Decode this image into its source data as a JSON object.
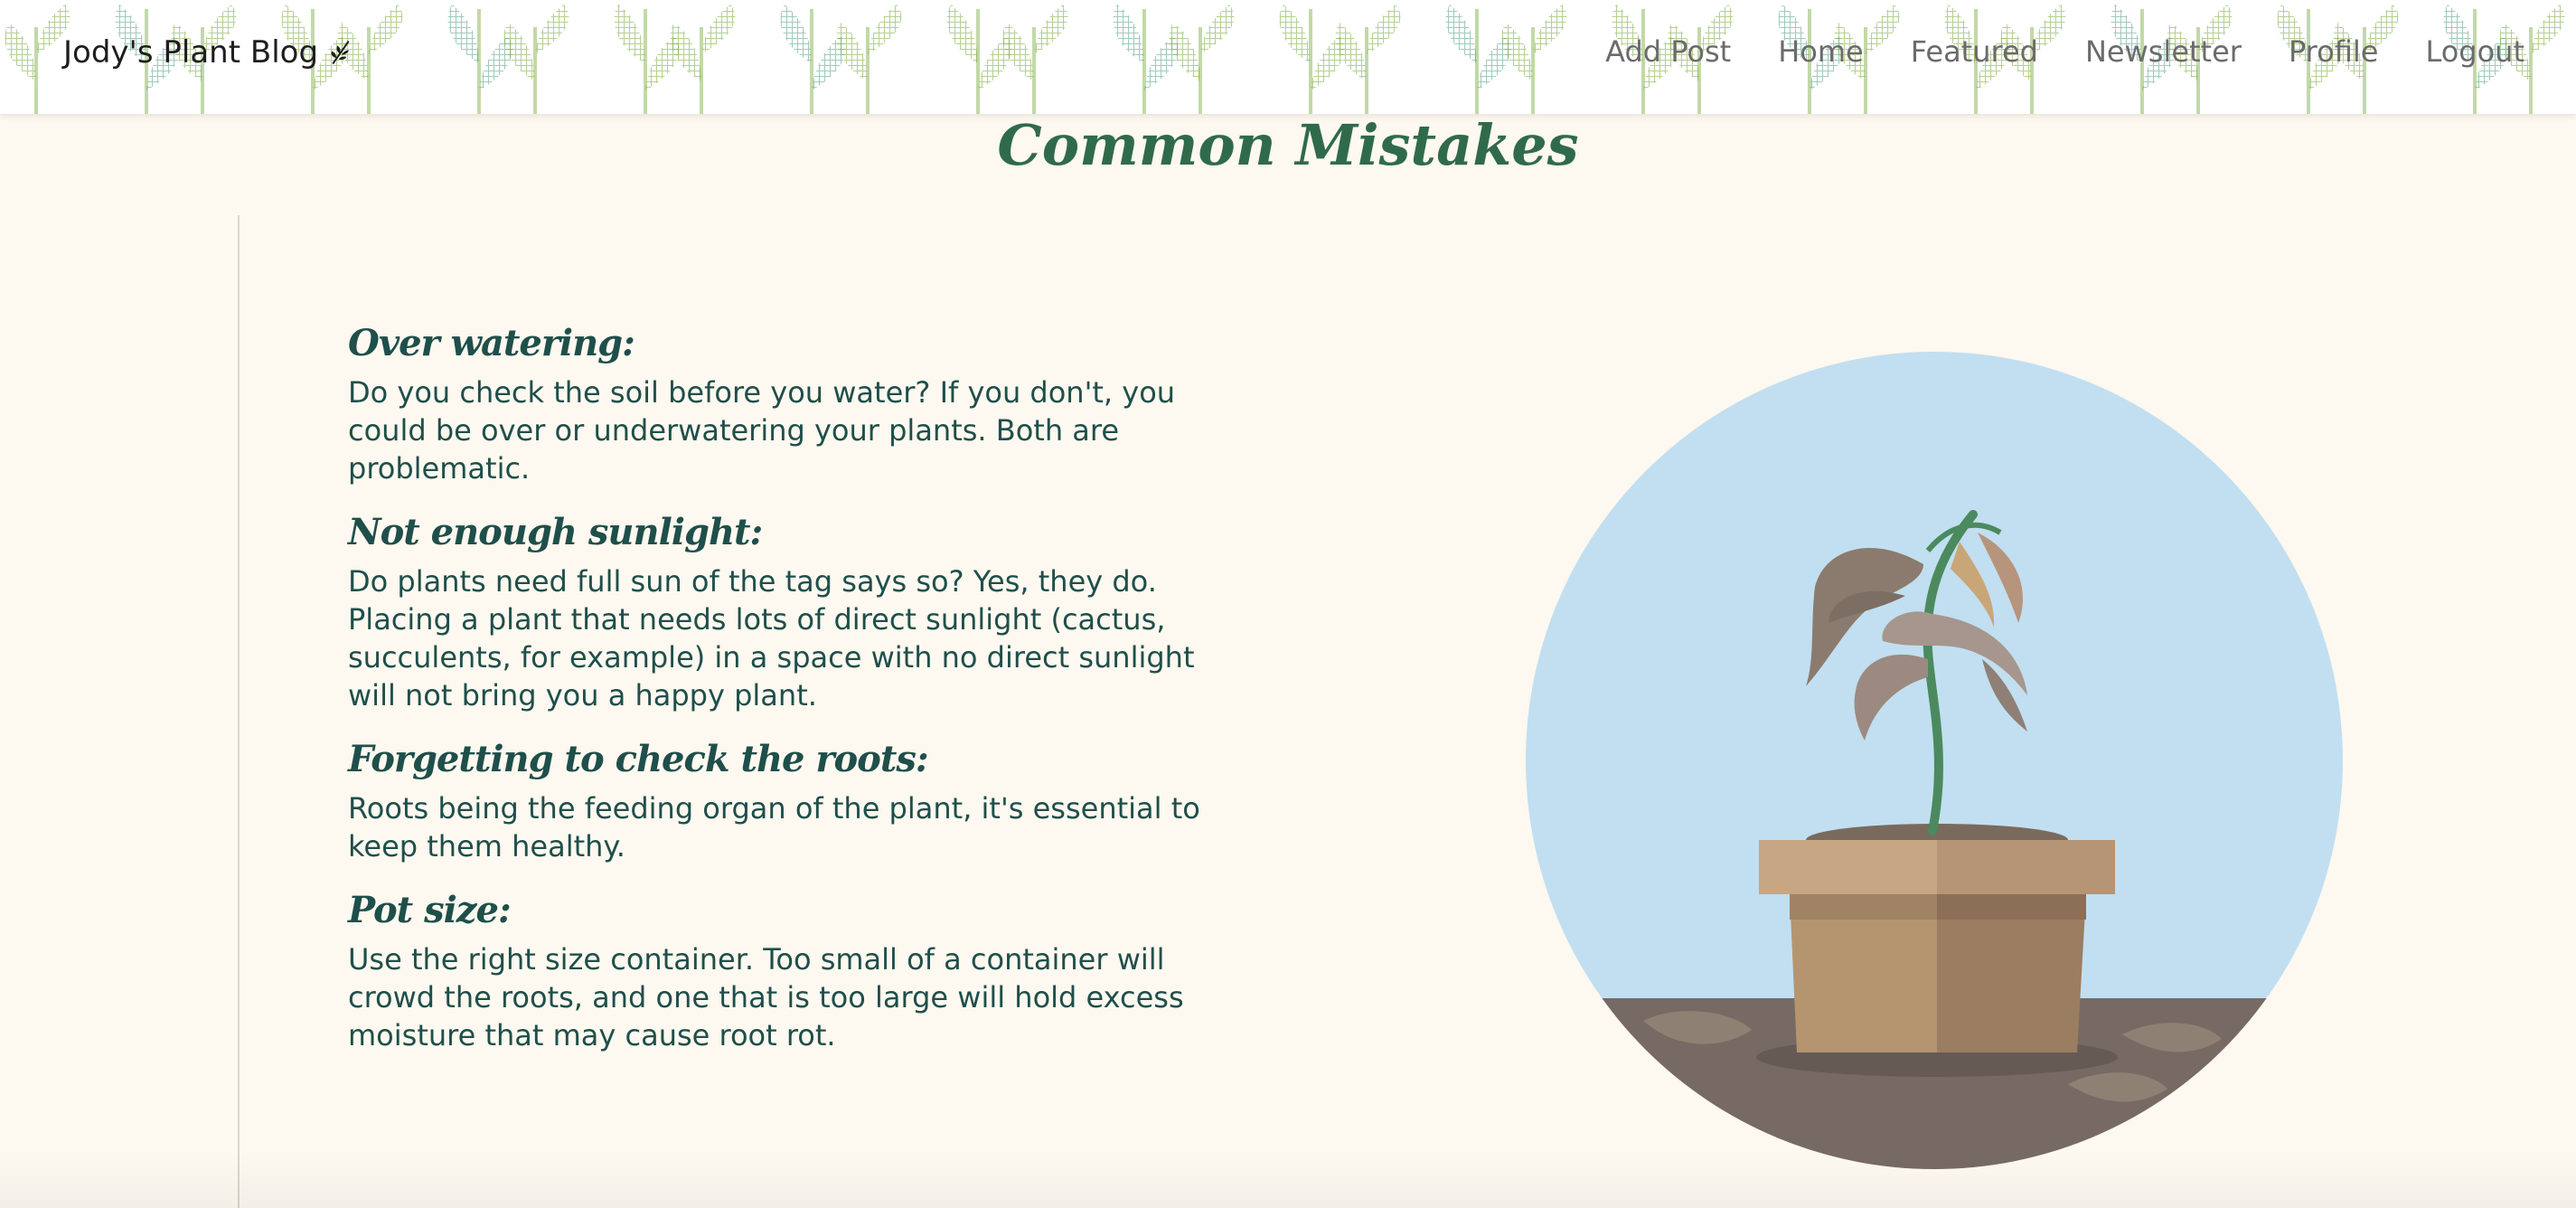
{
  "header": {
    "brand": "Jody's Plant Blog",
    "brand_icon": "leaf-sprig-icon",
    "nav": [
      "Add Post",
      "Home",
      "Featured",
      "Newsletter",
      "Profile",
      "Logout"
    ]
  },
  "page_title": "Common Mistakes",
  "sections": [
    {
      "heading": "Over watering:",
      "body": "Do you check the soil before you water? If you don't, you could be over or underwatering your plants. Both are problematic."
    },
    {
      "heading": "Not enough sunlight:",
      "body": "Do plants need full sun of the tag says so? Yes, they do. Placing a plant that needs lots of direct sunlight (cactus, succulents, for example) in a space with no direct sunlight will not bring you a happy plant."
    },
    {
      "heading": "Forgetting to check the roots:",
      "body": "Roots being the feeding organ of the plant, it's essential to keep them healthy."
    },
    {
      "heading": "Pot size:",
      "body": "Use the right size container. Too small of a container will crowd the roots, and one that is too large will hold excess moisture that may cause root rot."
    }
  ],
  "illustration": "wilting-potted-plant-illustration",
  "colors": {
    "background": "#fdf8f0",
    "title_green": "#2f6b4b",
    "text_teal": "#1f4f4a",
    "nav_gray": "#6b6b6b",
    "sky": "#c1dff0",
    "ground": "#776a64",
    "pot_light": "#c7a684",
    "pot_dark": "#9b7d62"
  }
}
